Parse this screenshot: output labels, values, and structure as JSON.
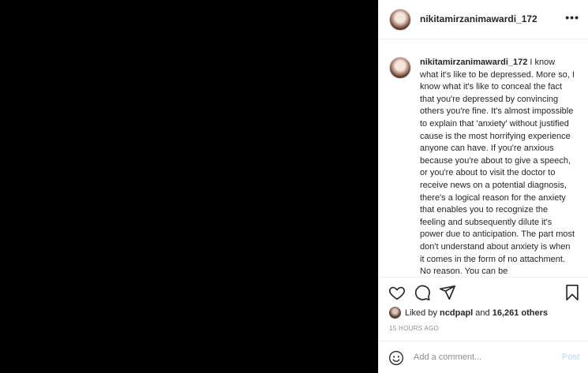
{
  "post": {
    "username": "nikitamirzanimawardi_172",
    "more_label": "•••",
    "caption_username": "nikitamirzanimawardi_172",
    "caption_text": "I know what it's like to be depressed. More so, I know what it's like to conceal the fact that you're depressed by convincing others you're fine. It's almost impossible to explain that 'anxiety' without justified cause is the most horrifying experience anyone can have. If you're anxious because you're about to give a speech, or you're about to visit the doctor to receive news on a potential diagnosis, there's a logical reason for the anxiety that enables you to recognize the feeling and subsequently dilute it's power due to anticipation. The part most don't understand about anxiety is when it comes in the form of no attachment. No reason. You can be",
    "likes": {
      "prefix": "Liked by",
      "liker": "ncdpapl",
      "joiner": "and",
      "others": "16,261 others"
    },
    "timestamp": "15 HOURS AGO",
    "comment_placeholder": "Add a comment...",
    "post_label": "Post"
  },
  "icons": {
    "like": "heart-icon",
    "comment": "comment-icon",
    "share": "send-icon",
    "save": "bookmark-icon",
    "emoji": "smiley-icon"
  },
  "colors": {
    "media_background": "#000000",
    "post_button": "#b3dbff",
    "muted_text": "#8e8e8e"
  }
}
